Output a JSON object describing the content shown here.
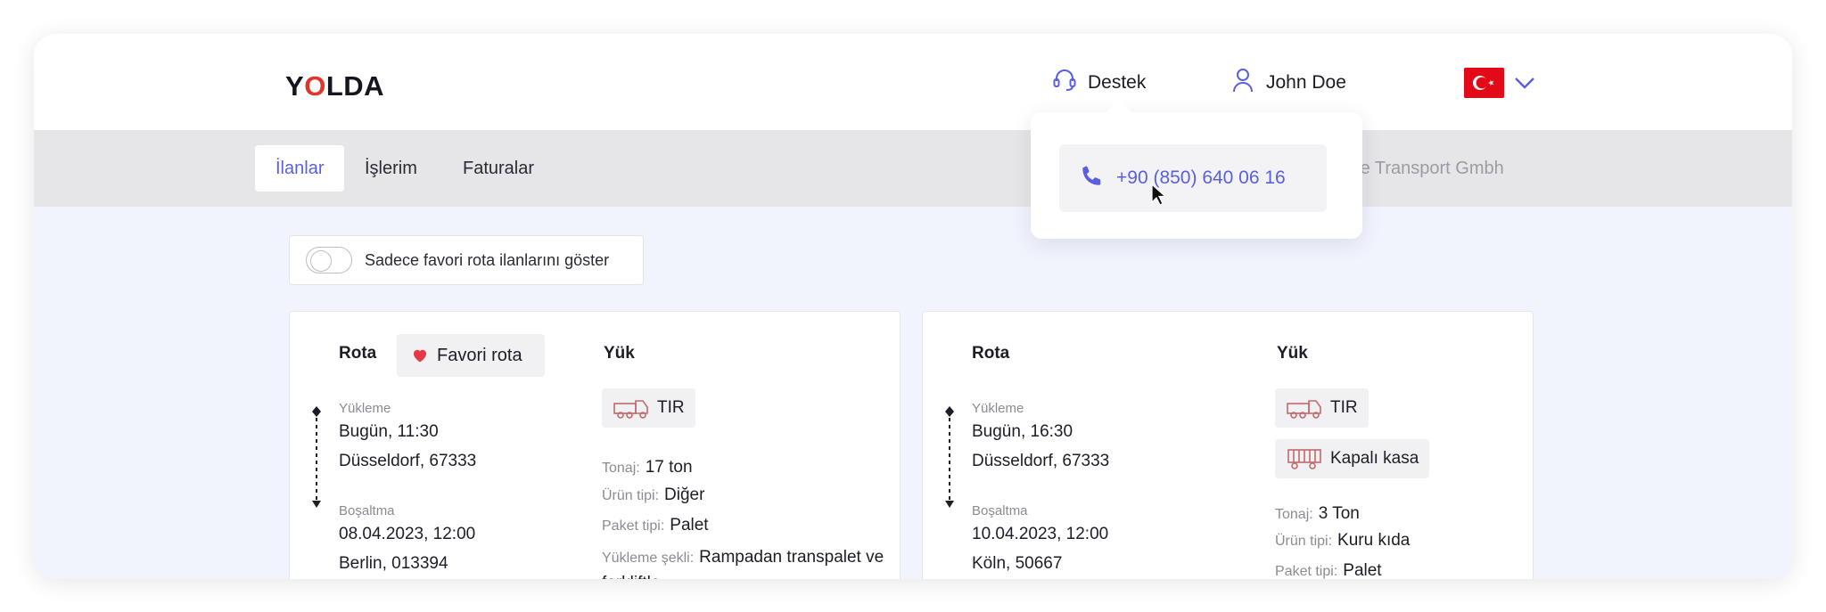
{
  "header": {
    "logo": "YOLDA",
    "support_label": "Destek",
    "user_name": "John Doe",
    "language_flag": "turkey-flag-icon"
  },
  "tabs": [
    {
      "label": "İlanlar",
      "active": true
    },
    {
      "label": "İşlerim",
      "active": false
    },
    {
      "label": "Faturalar",
      "active": false
    }
  ],
  "company_name": "Doe Transport Gmbh",
  "support_popover": {
    "phone": "+90 (850) 640 06 16"
  },
  "filter": {
    "favorite_toggle_label": "Sadece favori rota ilanlarını göster",
    "favorite_toggle_on": false
  },
  "colors": {
    "accent": "#5a5fe0",
    "brand_red": "#e2342b",
    "heart": "#e53945"
  },
  "listings": [
    {
      "route_label": "Rota",
      "favorite_badge": "Favori rota",
      "loading_label": "Yükleme",
      "loading_time": "Bugün, 11:30",
      "loading_place": "Düsseldorf, 67333",
      "unloading_label": "Boşaltma",
      "unloading_time": "08.04.2023, 12:00",
      "unloading_place": "Berlin, 013394",
      "cargo_label": "Yük",
      "vehicle": "TIR",
      "tonnage_key": "Tonaj:",
      "tonnage": "17 ton",
      "product_key": "Ürün tipi:",
      "product": "Diğer",
      "package_key": "Paket tipi:",
      "package": "Palet",
      "loading_method_key": "Yükleme şekli:",
      "loading_method": "Rampadan transpalet ve forkliftle"
    },
    {
      "route_label": "Rota",
      "loading_label": "Yükleme",
      "loading_time": "Bugün, 16:30",
      "loading_place": "Düsseldorf, 67333",
      "unloading_label": "Boşaltma",
      "unloading_time": "10.04.2023, 12:00",
      "unloading_place": "Köln, 50667",
      "cargo_label": "Yük",
      "vehicle": "TIR",
      "body_type": "Kapalı kasa",
      "tonnage_key": "Tonaj:",
      "tonnage": "3 Ton",
      "product_key": "Ürün tipi:",
      "product": "Kuru kıda",
      "package_key": "Paket tipi:",
      "package": "Palet"
    }
  ]
}
